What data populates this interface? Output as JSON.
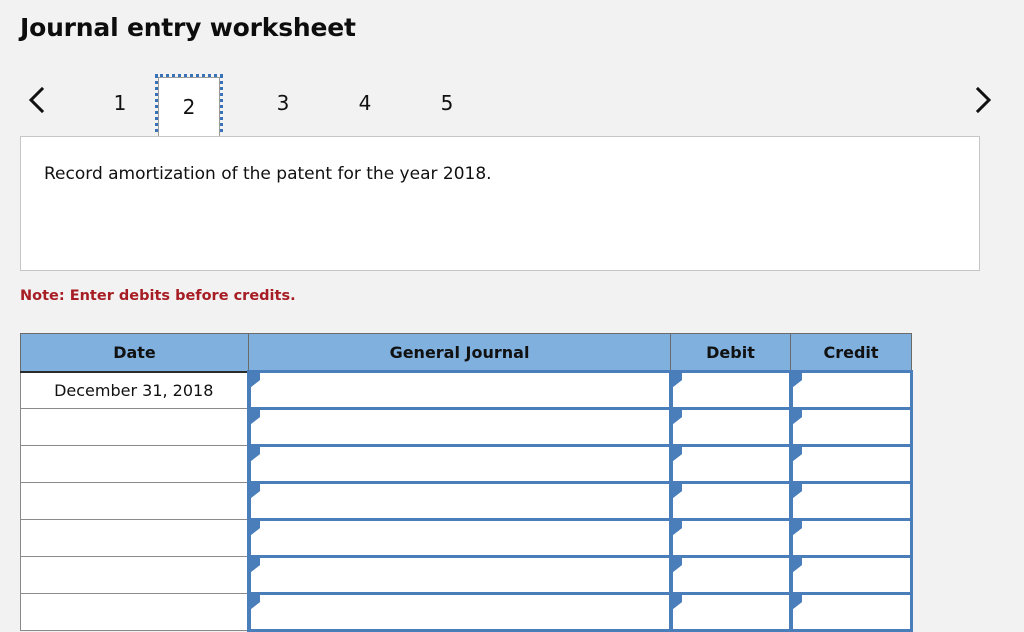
{
  "page": {
    "title": "Journal entry worksheet",
    "background_color": "#f2f2f2"
  },
  "pager": {
    "prev_label": "‹",
    "next_label": "›",
    "prev_icon": "chevron-left-icon",
    "next_icon": "chevron-right-icon",
    "selected_index": 1,
    "focus_outline_color": "#3a72b8",
    "tabs": [
      {
        "label": "1",
        "selected": false
      },
      {
        "label": "2",
        "selected": true
      },
      {
        "label": "3",
        "selected": false
      },
      {
        "label": "4",
        "selected": false
      },
      {
        "label": "5",
        "selected": false
      }
    ]
  },
  "instruction": {
    "text": "Record amortization of the patent for the year 2018."
  },
  "note": {
    "text": "Note: Enter debits before credits.",
    "color": "#a71d24"
  },
  "journal": {
    "header_color": "#7fb0de",
    "input_border_color": "#4a7ebb",
    "columns": [
      {
        "key": "date",
        "label": "Date"
      },
      {
        "key": "general_journal",
        "label": "General Journal"
      },
      {
        "key": "debit",
        "label": "Debit"
      },
      {
        "key": "credit",
        "label": "Credit"
      }
    ],
    "rows": [
      {
        "date": "December 31, 2018",
        "general_journal": "",
        "debit": "",
        "credit": ""
      },
      {
        "date": "",
        "general_journal": "",
        "debit": "",
        "credit": ""
      },
      {
        "date": "",
        "general_journal": "",
        "debit": "",
        "credit": ""
      },
      {
        "date": "",
        "general_journal": "",
        "debit": "",
        "credit": ""
      },
      {
        "date": "",
        "general_journal": "",
        "debit": "",
        "credit": ""
      },
      {
        "date": "",
        "general_journal": "",
        "debit": "",
        "credit": ""
      },
      {
        "date": "",
        "general_journal": "",
        "debit": "",
        "credit": ""
      }
    ]
  }
}
